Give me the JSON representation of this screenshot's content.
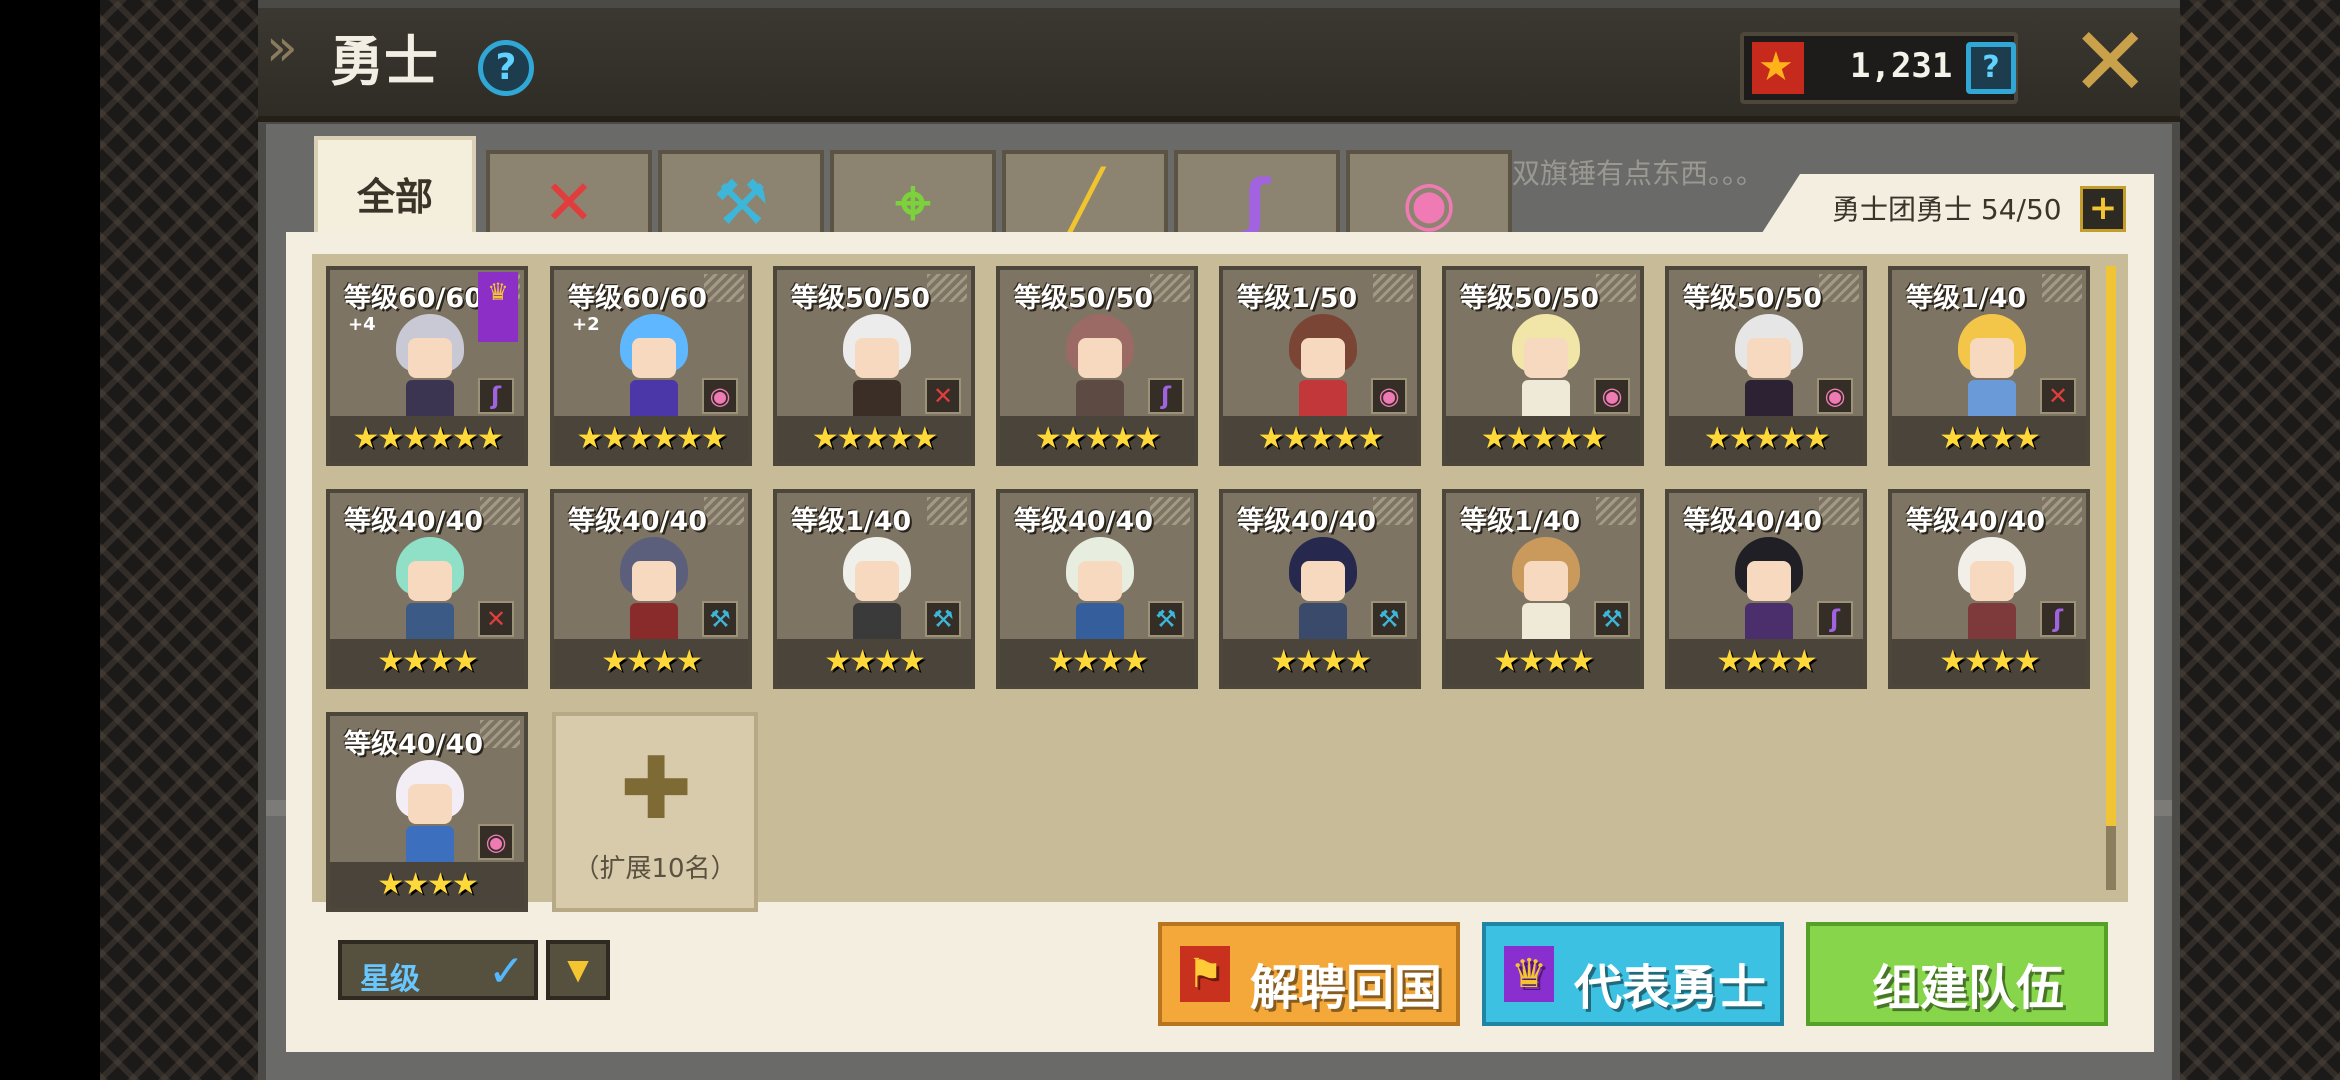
{
  "header": {
    "title": "勇士",
    "currency_value": "1,231"
  },
  "tabs": [
    {
      "label": "全部",
      "active": true
    },
    {
      "icon": "sword-icon",
      "color": "#e23d3d",
      "glyph": "✕"
    },
    {
      "icon": "hammer-icon",
      "color": "#3eb6d9",
      "glyph": "⚒"
    },
    {
      "icon": "bow-icon",
      "color": "#7bd23a",
      "glyph": "⌖"
    },
    {
      "icon": "gun-icon",
      "color": "#f0c42f",
      "glyph": "╱"
    },
    {
      "icon": "staff-icon",
      "color": "#a263e0",
      "glyph": "ʃ"
    },
    {
      "icon": "orb-icon",
      "color": "#f07bb4",
      "glyph": "◉"
    }
  ],
  "ghost_text": "双旗锤有点东西。。。",
  "roster": {
    "label": "勇士团勇士 54/50"
  },
  "heroes": [
    {
      "level": "等级60/60",
      "stars": "★★★★★★",
      "weapon_glyph": "ʃ",
      "weapon_color": "#a263e0",
      "hair": "#c9c9d6",
      "body": "#3b3552",
      "badge": "+4",
      "banner": true
    },
    {
      "level": "等级60/60",
      "stars": "★★★★★★",
      "weapon_glyph": "◉",
      "weapon_color": "#f07bb4",
      "hair": "#5fb7ff",
      "body": "#4b37a8",
      "badge": "+2"
    },
    {
      "level": "等级50/50",
      "stars": "★★★★★",
      "weapon_glyph": "✕",
      "weapon_color": "#e23d3d",
      "hair": "#ececec",
      "body": "#3b2e27"
    },
    {
      "level": "等级50/50",
      "stars": "★★★★★",
      "weapon_glyph": "ʃ",
      "weapon_color": "#a263e0",
      "hair": "#9b6a64",
      "body": "#5d4b43"
    },
    {
      "level": "等级1/50",
      "stars": "★★★★★",
      "weapon_glyph": "◉",
      "weapon_color": "#f07bb4",
      "hair": "#7a4535",
      "body": "#c2383a"
    },
    {
      "level": "等级50/50",
      "stars": "★★★★★",
      "weapon_glyph": "◉",
      "weapon_color": "#f07bb4",
      "hair": "#f1e6a8",
      "body": "#efe9d7"
    },
    {
      "level": "等级50/50",
      "stars": "★★★★★",
      "weapon_glyph": "◉",
      "weapon_color": "#f07bb4",
      "hair": "#e6e6e6",
      "body": "#2c2233"
    },
    {
      "level": "等级1/40",
      "stars": "★★★★",
      "weapon_glyph": "✕",
      "weapon_color": "#e23d3d",
      "hair": "#f3c64a",
      "body": "#6a9ad8"
    },
    {
      "level": "等级40/40",
      "stars": "★★★★",
      "weapon_glyph": "✕",
      "weapon_color": "#e23d3d",
      "hair": "#8fe0c6",
      "body": "#3c5a86"
    },
    {
      "level": "等级40/40",
      "stars": "★★★★",
      "weapon_glyph": "⚒",
      "weapon_color": "#3eb6d9",
      "hair": "#5c5f7c",
      "body": "#8a2b2b"
    },
    {
      "level": "等级1/40",
      "stars": "★★★★",
      "weapon_glyph": "⚒",
      "weapon_color": "#3eb6d9",
      "hair": "#f0f0ea",
      "body": "#3a3a3a"
    },
    {
      "level": "等级40/40",
      "stars": "★★★★",
      "weapon_glyph": "⚒",
      "weapon_color": "#3eb6d9",
      "hair": "#e7eee0",
      "body": "#345f9c"
    },
    {
      "level": "等级40/40",
      "stars": "★★★★",
      "weapon_glyph": "⚒",
      "weapon_color": "#3eb6d9",
      "hair": "#26284d",
      "body": "#394a6a"
    },
    {
      "level": "等级1/40",
      "stars": "★★★★",
      "weapon_glyph": "⚒",
      "weapon_color": "#3eb6d9",
      "hair": "#c99a5c",
      "body": "#efe9d7"
    },
    {
      "level": "等级40/40",
      "stars": "★★★★",
      "weapon_glyph": "ʃ",
      "weapon_color": "#a263e0",
      "hair": "#1f1f25",
      "body": "#4b2f6d"
    },
    {
      "level": "等级40/40",
      "stars": "★★★★",
      "weapon_glyph": "ʃ",
      "weapon_color": "#a263e0",
      "hair": "#f2efe8",
      "body": "#7e3a3a"
    },
    {
      "level": "等级40/40",
      "stars": "★★★★",
      "weapon_glyph": "◉",
      "weapon_color": "#f07bb4",
      "hair": "#f3eef5",
      "body": "#3c6fbd"
    }
  ],
  "expand": {
    "label": "（扩展10名）"
  },
  "sort": {
    "label": "星级"
  },
  "buttons": {
    "dismiss": "解聘回国",
    "representative": "代表勇士",
    "team": "组建队伍"
  }
}
